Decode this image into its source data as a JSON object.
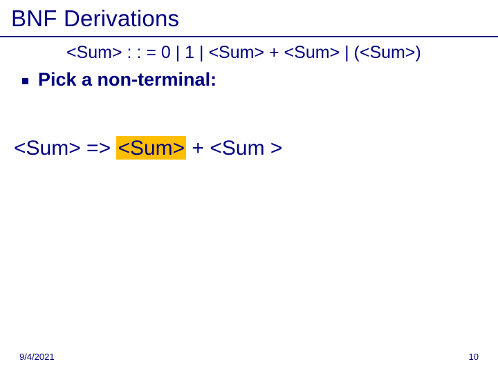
{
  "title": "BNF Derivations",
  "grammar": "<Sum> : : = 0 | 1 | <Sum> + <Sum> | (<Sum>)",
  "bullet": "Pick a non-terminal:",
  "deriv_left": "<Sum> => ",
  "deriv_hl": "<Sum>",
  "deriv_right": " + <Sum >",
  "footer_date": "9/4/2021",
  "footer_page": "10"
}
